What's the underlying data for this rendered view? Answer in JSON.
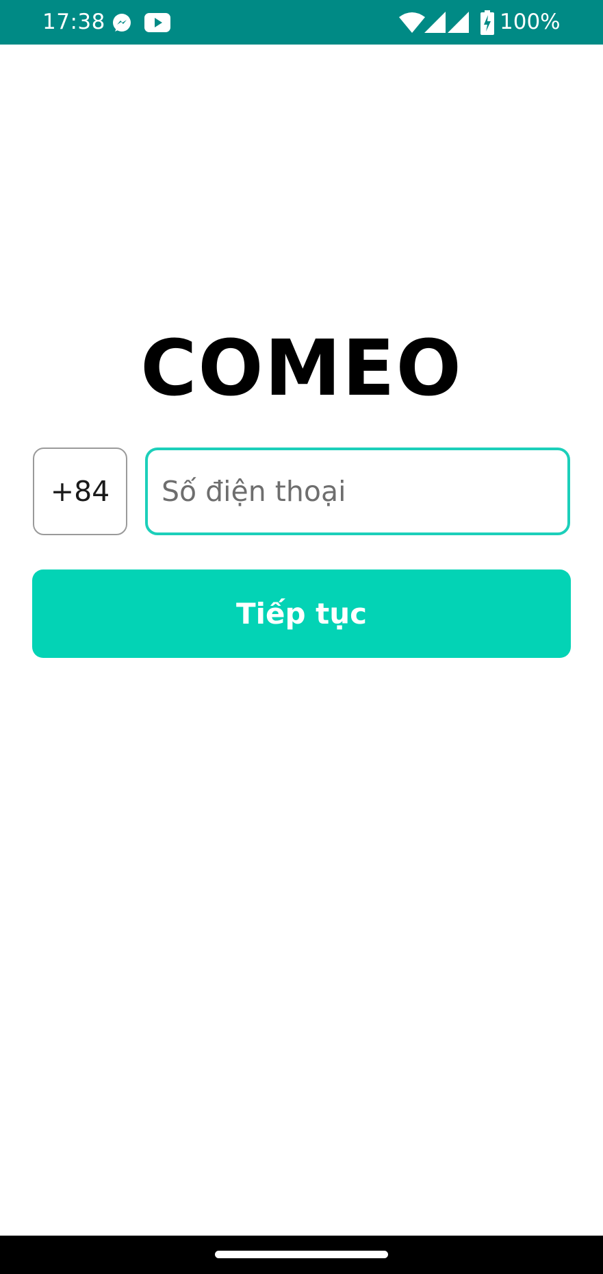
{
  "status_bar": {
    "time": "17:38",
    "battery_percent": "100%",
    "notification_icons": [
      "messenger-icon",
      "youtube-icon"
    ],
    "system_icons": [
      "wifi-icon",
      "signal-icon",
      "signal-icon",
      "battery-charging-icon"
    ],
    "background_color": "#008a85"
  },
  "app": {
    "logo_text": "COMEO"
  },
  "login": {
    "country_code": "+84",
    "phone_placeholder": "Số điện thoại",
    "phone_value": "",
    "continue_label": "Tiếp tục",
    "accent_color": "#03d3b5",
    "focus_border_color": "#1ccfba"
  }
}
